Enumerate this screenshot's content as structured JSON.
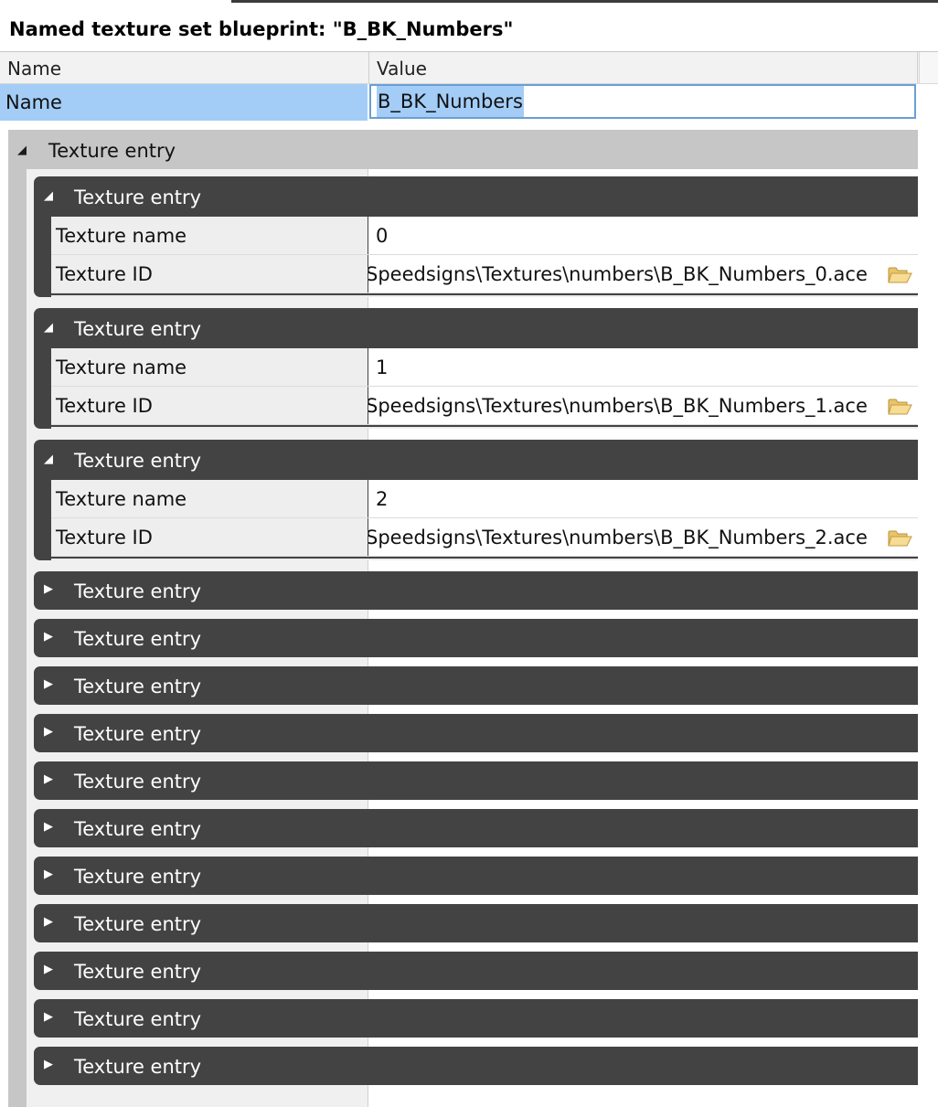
{
  "window": {
    "title": "Named texture set blueprint: \"B_BK_Numbers\""
  },
  "columns": {
    "name": "Name",
    "value": "Value"
  },
  "name_row": {
    "label": "Name",
    "value": "B_BK_Numbers"
  },
  "outer_entry": {
    "label": "Texture entry"
  },
  "entries": [
    {
      "label": "Texture entry",
      "expanded": true,
      "texture_name_label": "Texture name",
      "texture_name": "0",
      "texture_id_label": "Texture ID",
      "texture_id": "Speedsigns\\Textures\\numbers\\B_BK_Numbers_0.ace"
    },
    {
      "label": "Texture entry",
      "expanded": true,
      "texture_name_label": "Texture name",
      "texture_name": "1",
      "texture_id_label": "Texture ID",
      "texture_id": "Speedsigns\\Textures\\numbers\\B_BK_Numbers_1.ace"
    },
    {
      "label": "Texture entry",
      "expanded": true,
      "texture_name_label": "Texture name",
      "texture_name": "2",
      "texture_id_label": "Texture ID",
      "texture_id": "Speedsigns\\Textures\\numbers\\B_BK_Numbers_2.ace"
    },
    {
      "label": "Texture entry",
      "expanded": false
    },
    {
      "label": "Texture entry",
      "expanded": false
    },
    {
      "label": "Texture entry",
      "expanded": false
    },
    {
      "label": "Texture entry",
      "expanded": false
    },
    {
      "label": "Texture entry",
      "expanded": false
    },
    {
      "label": "Texture entry",
      "expanded": false
    },
    {
      "label": "Texture entry",
      "expanded": false
    },
    {
      "label": "Texture entry",
      "expanded": false
    },
    {
      "label": "Texture entry",
      "expanded": false
    },
    {
      "label": "Texture entry",
      "expanded": false
    },
    {
      "label": "Texture entry",
      "expanded": false
    }
  ],
  "icons": {
    "expanded": "triangle-down-icon",
    "collapsed": "triangle-right-icon",
    "browse": "folder-open-icon"
  },
  "colors": {
    "selection": "#a3cdf7",
    "entry_bar": "#434343",
    "outer_bar": "#c6c6c6",
    "focus_border": "#6a9fd4"
  }
}
